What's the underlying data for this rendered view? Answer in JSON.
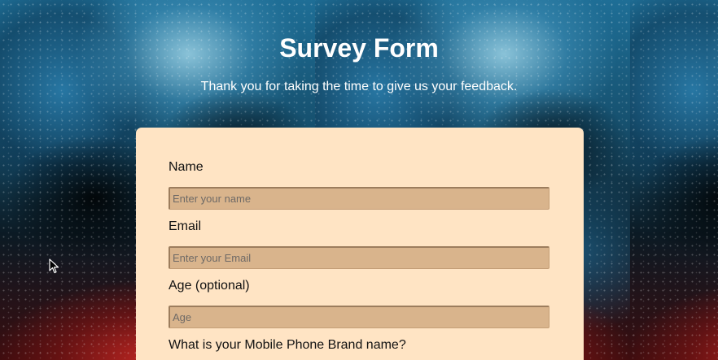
{
  "header": {
    "title": "Survey Form",
    "description": "Thank you for taking the time to give us your feedback."
  },
  "form": {
    "name": {
      "label": "Name",
      "placeholder": "Enter your name",
      "value": ""
    },
    "email": {
      "label": "Email",
      "placeholder": "Enter your Email",
      "value": ""
    },
    "age": {
      "label": "Age (optional)",
      "placeholder": "Age",
      "value": ""
    },
    "phone_brand": {
      "label": "What is your Mobile Phone Brand name?"
    }
  },
  "colors": {
    "card_background": "#ffe4c4",
    "input_background": "#d9b48c",
    "title_text": "#ffffff"
  },
  "icons": {
    "cursor": "mouse-pointer-icon"
  }
}
